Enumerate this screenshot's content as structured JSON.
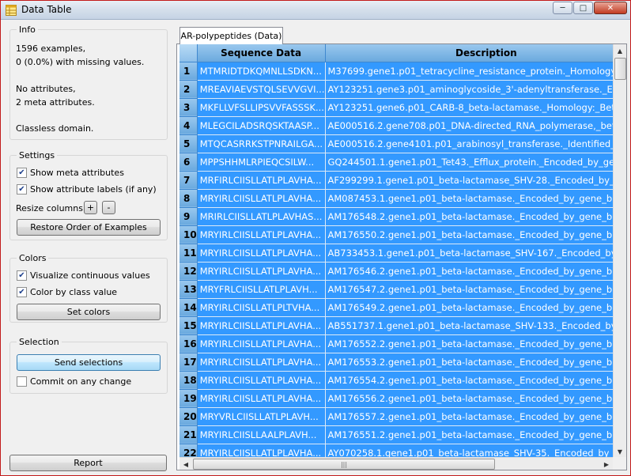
{
  "window": {
    "title": "Data Table"
  },
  "info": {
    "title": "Info",
    "lines": [
      "1596 examples,",
      "0 (0.0%) with missing values.",
      "No attributes,",
      "2 meta attributes.",
      "Classless domain."
    ]
  },
  "settings": {
    "title": "Settings",
    "show_meta": "Show meta attributes",
    "show_labels": "Show attribute labels (if any)",
    "resize_label": "Resize columns:",
    "plus": "+",
    "minus": "-",
    "restore": "Restore Order of Examples"
  },
  "colors": {
    "title": "Colors",
    "visualize": "Visualize continuous values",
    "color_by_class": "Color by class value",
    "set_colors": "Set colors"
  },
  "selection": {
    "title": "Selection",
    "send": "Send selections",
    "commit": "Commit on any change"
  },
  "report": "Report",
  "tab": "AR-polypeptides (Data)",
  "table": {
    "columns": [
      "Sequence Data",
      "Description"
    ],
    "rows": [
      [
        "1",
        "MTMRIDTDKQMNLLSDKN...",
        "M37699.gene1.p01_tetracycline_resistance_protein._Homology:_Mo"
      ],
      [
        "2",
        "MREAVIAEVSTQLSEVVGVI...",
        "AY123251.gene3.p01_aminoglycoside_3'-adenyltransferase._Encode"
      ],
      [
        "3",
        "MKFLLVFSLLIPSVVFASSSK...",
        "AY123251.gene6.p01_CARB-8_beta-lactamase._Homology:_Beta-lac"
      ],
      [
        "4",
        "MLEGCILADSRQSKTAASP...",
        "AE000516.2.gene708.p01_DNA-directed_RNA_polymerase,_beta_sub"
      ],
      [
        "5",
        "MTQCASRRKSTPNRAILGA...",
        "AE000516.2.gene4101.p01_arabinosyl_transferase._Identified_by_sim"
      ],
      [
        "6",
        "MPPSHHMLRPIEQCSILW...",
        "GQ244501.1.gene1.p01_Tet43._Efflux_protein._Encoded_by_gene_tet"
      ],
      [
        "7",
        "MRFIRLCIISLLATLPLAVHA...",
        "AF299299.1.gene1.p01_beta-lactamase_SHV-28._Encoded_by_gene_"
      ],
      [
        "8",
        "MRYIRLCIISLLATLPLAVHA...",
        "AM087453.1.gene1.p01_beta-lactamase._Encoded_by_gene_blaSHV"
      ],
      [
        "9",
        "MRIRLCIISLLATLPLAVHAS...",
        "AM176548.2.gene1.p01_beta-lactamase._Encoded_by_gene_blaSHV"
      ],
      [
        "10",
        "MRYIRLCIISLLATLPLAVHA...",
        "AM176550.2.gene1.p01_beta-lactamase._Encoded_by_gene_blaSHV"
      ],
      [
        "11",
        "MRYIRLCIISLLATLPLAVHA...",
        "AB733453.1.gene1.p01_beta-lactamase_SHV-167._Encoded_by_gene"
      ],
      [
        "12",
        "MRYIRLCIISLLATLPLAVHA...",
        "AM176546.2.gene1.p01_beta-lactamase._Encoded_by_gene_blaSHV"
      ],
      [
        "13",
        "MRYFRLCIISLLATLPLAVH...",
        "AM176547.2.gene1.p01_beta-lactamase._Encoded_by_gene_blaSHV"
      ],
      [
        "14",
        "MRYIRLCIISLLATLPLTVHA...",
        "AM176549.2.gene1.p01_beta-lactamase._Encoded_by_gene_blaSHV"
      ],
      [
        "15",
        "MRYIRLCIISLLATLPLAVHA...",
        "AB551737.1.gene1.p01_beta-lactamase_SHV-133._Encoded_by_gene"
      ],
      [
        "16",
        "MRYIRLCIISLLATLPLAVHA...",
        "AM176552.2.gene1.p01_beta-lactamase._Encoded_by_gene_blaSHV"
      ],
      [
        "17",
        "MRYIRLCIISLLATLPLAVHA...",
        "AM176553.2.gene1.p01_beta-lactamase._Encoded_by_gene_blaSHV"
      ],
      [
        "18",
        "MRYIRLCIISLLATLPLAVHA...",
        "AM176554.2.gene1.p01_beta-lactamase._Encoded_by_gene_blaSHV"
      ],
      [
        "19",
        "MRYIRLCIISLLATLPLAVHA...",
        "AM176556.2.gene1.p01_beta-lactamase._Encoded_by_gene_blaSHV"
      ],
      [
        "20",
        "MRYVRLCIISLLATLPLAVH...",
        "AM176557.2.gene1.p01_beta-lactamase._Encoded_by_gene_blaSHV"
      ],
      [
        "21",
        "MRYIRLCIISLLAALPLAVH...",
        "AM176551.2.gene1.p01_beta-lactamase._Encoded_by_gene_blaSHV"
      ],
      [
        "22",
        "MRYIRLCIISLLATLPLAVHA...",
        "AY070258.1.gene1.p01_beta-lactamase_SHV-35._Encoded_by_gene_"
      ]
    ]
  },
  "colors_theme": {
    "selection": "#3399ff",
    "header": "#7fb6e5",
    "frame": "#c21a1a"
  }
}
